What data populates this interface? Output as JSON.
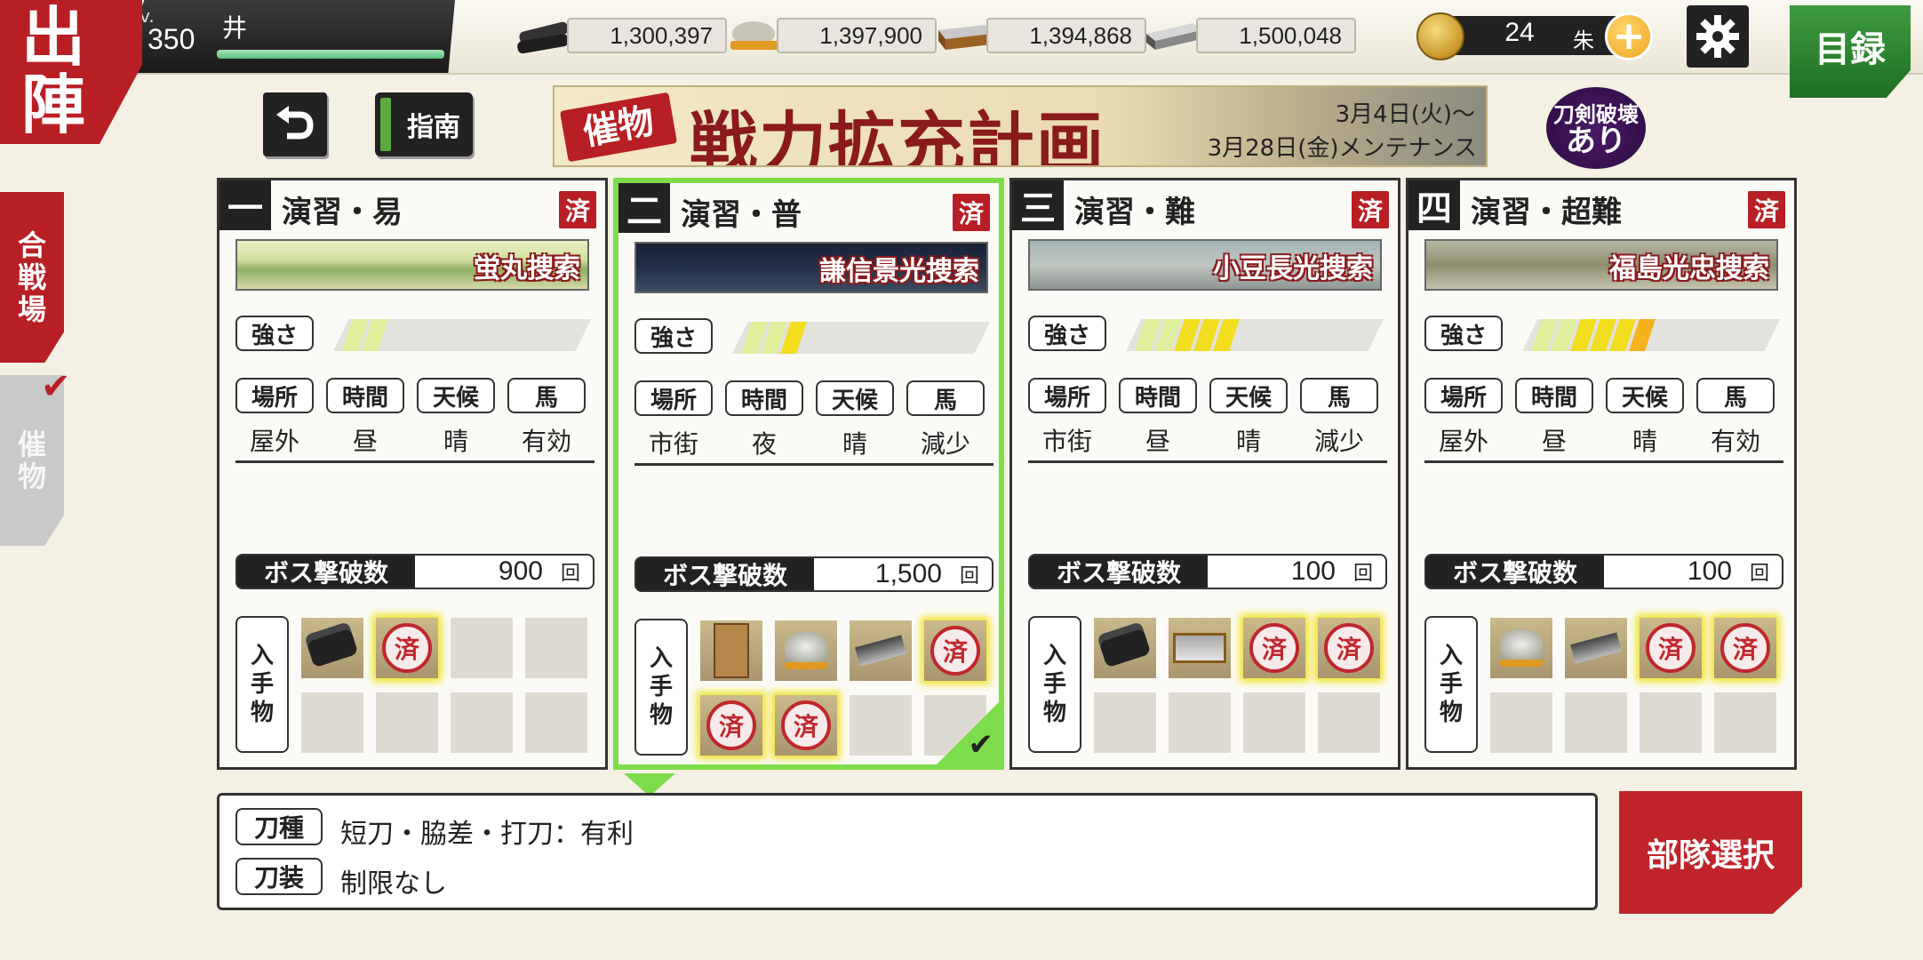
{
  "header": {
    "sortie_label": "出陣",
    "level_label": "Lv.",
    "level_value": "350",
    "player_name": "井",
    "resources": [
      {
        "icon": "charcoal-icon",
        "value": "1,300,397"
      },
      {
        "icon": "tamahagane-icon",
        "value": "1,397,900"
      },
      {
        "icon": "coolant-icon",
        "value": "1,394,868"
      },
      {
        "icon": "whetstone-icon",
        "value": "1,500,048"
      }
    ],
    "currency_value": "24",
    "currency_unit": "朱",
    "catalog_label": "目録"
  },
  "side_tabs": {
    "battle": "合戦場",
    "event": "催物"
  },
  "buttons": {
    "guide": "指南",
    "formation": "部隊選択"
  },
  "banner": {
    "tag": "催物",
    "title": "戦力拡充計画",
    "date_start": "3月4日(火)〜",
    "date_end": "3月28日(金)メンテナンス",
    "break_badge_line1": "刀剣破壊",
    "break_badge_line2": "あり"
  },
  "labels": {
    "done": "済",
    "strength": "強さ",
    "location": "場所",
    "time": "時間",
    "weather": "天候",
    "horse": "馬",
    "boss_kills": "ボス撃破数",
    "times_unit": "回",
    "drops": "入手物"
  },
  "stages": [
    {
      "num": "一",
      "title": "演習・易",
      "map_name": "蛍丸捜索",
      "strength": 2,
      "location": "屋外",
      "time": "昼",
      "weather": "晴",
      "horse": "有効",
      "boss_kills": "900",
      "selected": false
    },
    {
      "num": "二",
      "title": "演習・普",
      "map_name": "謙信景光捜索",
      "strength": 3,
      "location": "市街",
      "time": "夜",
      "weather": "晴",
      "horse": "減少",
      "boss_kills": "1,500",
      "selected": true
    },
    {
      "num": "三",
      "title": "演習・難",
      "map_name": "小豆長光捜索",
      "strength": 5,
      "location": "市街",
      "time": "昼",
      "weather": "晴",
      "horse": "減少",
      "boss_kills": "100",
      "selected": false
    },
    {
      "num": "四",
      "title": "演習・超難",
      "map_name": "福島光忠捜索",
      "strength": 6,
      "location": "屋外",
      "time": "昼",
      "weather": "晴",
      "horse": "有効",
      "boss_kills": "100",
      "selected": false
    }
  ],
  "info": {
    "sword_type_label": "刀種",
    "sword_type_value": "短刀・脇差・打刀：有利",
    "equipment_label": "刀装",
    "equipment_value": "制限なし"
  },
  "colors": {
    "brand_red": "#b81f24",
    "selected_green": "#7ddc4a",
    "catalog_green": "#2a8030"
  }
}
